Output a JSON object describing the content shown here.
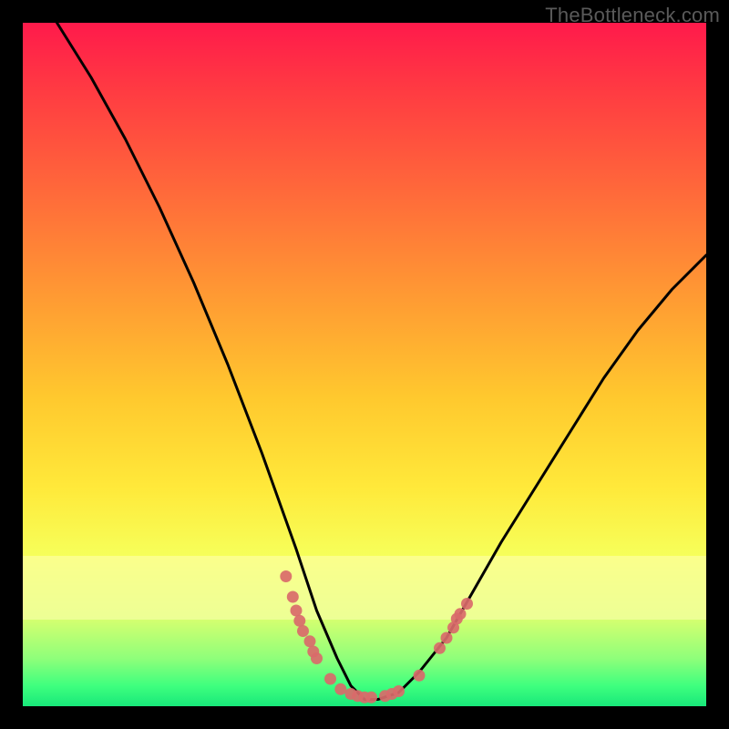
{
  "watermark": "TheBottleneck.com",
  "colors": {
    "frame": "#000000",
    "watermark": "#5a5a5a",
    "curve": "#000000",
    "dots": "#d96a6a"
  },
  "chart_data": {
    "type": "line",
    "title": "",
    "xlabel": "",
    "ylabel": "",
    "xlim": [
      0,
      100
    ],
    "ylim": [
      0,
      100
    ],
    "grid": false,
    "legend": false,
    "note": "Background gradient encodes y: red=high bottleneck, green=low. V-shaped curve dips to ~0 near x≈48-55 then rises.",
    "series": [
      {
        "name": "bottleneck-curve",
        "x": [
          5,
          10,
          15,
          20,
          25,
          30,
          35,
          40,
          43,
          46,
          48,
          50,
          52,
          55,
          58,
          62,
          66,
          70,
          75,
          80,
          85,
          90,
          95,
          100
        ],
        "values": [
          100,
          92,
          83,
          73,
          62,
          50,
          37,
          23,
          14,
          7,
          3,
          1,
          1,
          2,
          5,
          10,
          17,
          24,
          32,
          40,
          48,
          55,
          61,
          66
        ]
      }
    ],
    "markers": [
      {
        "x": 38.5,
        "y": 19
      },
      {
        "x": 39.5,
        "y": 16
      },
      {
        "x": 40.0,
        "y": 14
      },
      {
        "x": 40.5,
        "y": 12.5
      },
      {
        "x": 41.0,
        "y": 11
      },
      {
        "x": 42.0,
        "y": 9.5
      },
      {
        "x": 42.5,
        "y": 8
      },
      {
        "x": 43.0,
        "y": 7
      },
      {
        "x": 45.0,
        "y": 4
      },
      {
        "x": 46.5,
        "y": 2.5
      },
      {
        "x": 48.0,
        "y": 1.8
      },
      {
        "x": 49.0,
        "y": 1.5
      },
      {
        "x": 50.0,
        "y": 1.3
      },
      {
        "x": 51.0,
        "y": 1.3
      },
      {
        "x": 53.0,
        "y": 1.5
      },
      {
        "x": 54.0,
        "y": 1.8
      },
      {
        "x": 55.0,
        "y": 2.2
      },
      {
        "x": 58.0,
        "y": 4.5
      },
      {
        "x": 61.0,
        "y": 8.5
      },
      {
        "x": 62.0,
        "y": 10
      },
      {
        "x": 63.0,
        "y": 11.5
      },
      {
        "x": 63.5,
        "y": 12.8
      },
      {
        "x": 64.0,
        "y": 13.5
      },
      {
        "x": 65.0,
        "y": 15
      }
    ]
  }
}
